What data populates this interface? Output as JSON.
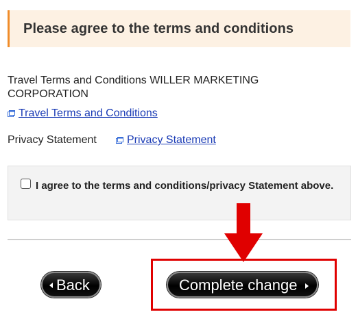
{
  "header": {
    "title": "Please agree to the terms and conditions"
  },
  "terms": {
    "description": "Travel Terms and Conditions WILLER MARKETING CORPORATION",
    "link_label": "Travel Terms and Conditions"
  },
  "privacy": {
    "label": "Privacy Statement",
    "link_label": "Privacy Statement"
  },
  "agreement": {
    "checked": false,
    "label": "I agree to the terms and conditions/privacy Statement above."
  },
  "buttons": {
    "back_label": "Back",
    "complete_label": "Complete change"
  },
  "annotation": {
    "highlight_color": "#e00000",
    "target": "Complete change"
  },
  "colors": {
    "header_accent": "#f08c2a",
    "header_bg": "#fdf1e3",
    "link": "#1a3bb5"
  }
}
